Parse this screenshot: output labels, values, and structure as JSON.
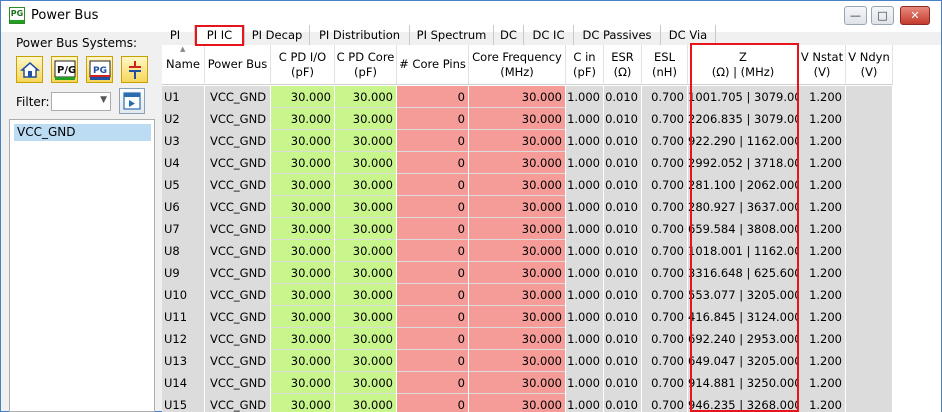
{
  "window": {
    "title": "Power Bus",
    "app_icon_text": "PG"
  },
  "sidebar": {
    "label": "Power Bus Systems:",
    "filter_label": "Filter:",
    "filter_value": "",
    "items": [
      "VCC_GND"
    ],
    "tool_icons": [
      "home-icon",
      "pg-edit-icon",
      "pg-icon",
      "capacitor-icon"
    ]
  },
  "tabs": [
    {
      "label": "PI"
    },
    {
      "label": "PI IC"
    },
    {
      "label": "PI Decap"
    },
    {
      "label": "PI Distribution"
    },
    {
      "label": "PI Spectrum"
    },
    {
      "label": "DC"
    },
    {
      "label": "DC IC"
    },
    {
      "label": "DC Passives"
    },
    {
      "label": "DC Via"
    }
  ],
  "active_tab": "PI IC",
  "table": {
    "headers": [
      [
        "Name",
        ""
      ],
      [
        "Power Bus",
        ""
      ],
      [
        "C PD I/O",
        "(pF)"
      ],
      [
        "C PD Core",
        "(pF)"
      ],
      [
        "# Core Pins",
        ""
      ],
      [
        "Core Frequency",
        "(MHz)"
      ],
      [
        "C in",
        "(pF)"
      ],
      [
        "ESR",
        "(Ω)"
      ],
      [
        "ESL",
        "(nH)"
      ],
      [
        "Z",
        "(Ω) | (MHz)"
      ],
      [
        "V Nstat",
        "(V)"
      ],
      [
        "V Ndyn",
        "(V)"
      ]
    ],
    "rows": [
      [
        "U1",
        "VCC_GND",
        "30.000",
        "30.000",
        "0",
        "30.000",
        "1.000",
        "0.010",
        "0.700",
        "1001.705 | 3079.000",
        "1.200",
        ""
      ],
      [
        "U2",
        "VCC_GND",
        "30.000",
        "30.000",
        "0",
        "30.000",
        "1.000",
        "0.010",
        "0.700",
        "2206.835 | 3079.000",
        "1.200",
        ""
      ],
      [
        "U3",
        "VCC_GND",
        "30.000",
        "30.000",
        "0",
        "30.000",
        "1.000",
        "0.010",
        "0.700",
        "922.290 | 1162.000",
        "1.200",
        ""
      ],
      [
        "U4",
        "VCC_GND",
        "30.000",
        "30.000",
        "0",
        "30.000",
        "1.000",
        "0.010",
        "0.700",
        "2992.052 | 3718.000",
        "1.200",
        ""
      ],
      [
        "U5",
        "VCC_GND",
        "30.000",
        "30.000",
        "0",
        "30.000",
        "1.000",
        "0.010",
        "0.700",
        "281.100 | 2062.000",
        "1.200",
        ""
      ],
      [
        "U6",
        "VCC_GND",
        "30.000",
        "30.000",
        "0",
        "30.000",
        "1.000",
        "0.010",
        "0.700",
        "280.927 | 3637.000",
        "1.200",
        ""
      ],
      [
        "U7",
        "VCC_GND",
        "30.000",
        "30.000",
        "0",
        "30.000",
        "1.000",
        "0.010",
        "0.700",
        "659.584 | 3808.000",
        "1.200",
        ""
      ],
      [
        "U8",
        "VCC_GND",
        "30.000",
        "30.000",
        "0",
        "30.000",
        "1.000",
        "0.010",
        "0.700",
        "1018.001 | 1162.000",
        "1.200",
        ""
      ],
      [
        "U9",
        "VCC_GND",
        "30.000",
        "30.000",
        "0",
        "30.000",
        "1.000",
        "0.010",
        "0.700",
        "3316.648 | 625.600",
        "1.200",
        ""
      ],
      [
        "U10",
        "VCC_GND",
        "30.000",
        "30.000",
        "0",
        "30.000",
        "1.000",
        "0.010",
        "0.700",
        "553.077 | 3205.000",
        "1.200",
        ""
      ],
      [
        "U11",
        "VCC_GND",
        "30.000",
        "30.000",
        "0",
        "30.000",
        "1.000",
        "0.010",
        "0.700",
        "416.845 | 3124.000",
        "1.200",
        ""
      ],
      [
        "U12",
        "VCC_GND",
        "30.000",
        "30.000",
        "0",
        "30.000",
        "1.000",
        "0.010",
        "0.700",
        "692.240 | 2953.000",
        "1.200",
        ""
      ],
      [
        "U13",
        "VCC_GND",
        "30.000",
        "30.000",
        "0",
        "30.000",
        "1.000",
        "0.010",
        "0.700",
        "649.047 | 3205.000",
        "1.200",
        ""
      ],
      [
        "U14",
        "VCC_GND",
        "30.000",
        "30.000",
        "0",
        "30.000",
        "1.000",
        "0.010",
        "0.700",
        "914.881 | 3250.000",
        "1.200",
        ""
      ],
      [
        "U15",
        "VCC_GND",
        "30.000",
        "30.000",
        "0",
        "30.000",
        "1.000",
        "0.010",
        "0.700",
        "946.235 | 3268.000",
        "1.200",
        ""
      ]
    ]
  },
  "colors": {
    "editable_green": "#c8f58c",
    "editable_red": "#f59b98",
    "readonly_gray": "#dcdcdc",
    "highlight_red": "#e8141c"
  }
}
